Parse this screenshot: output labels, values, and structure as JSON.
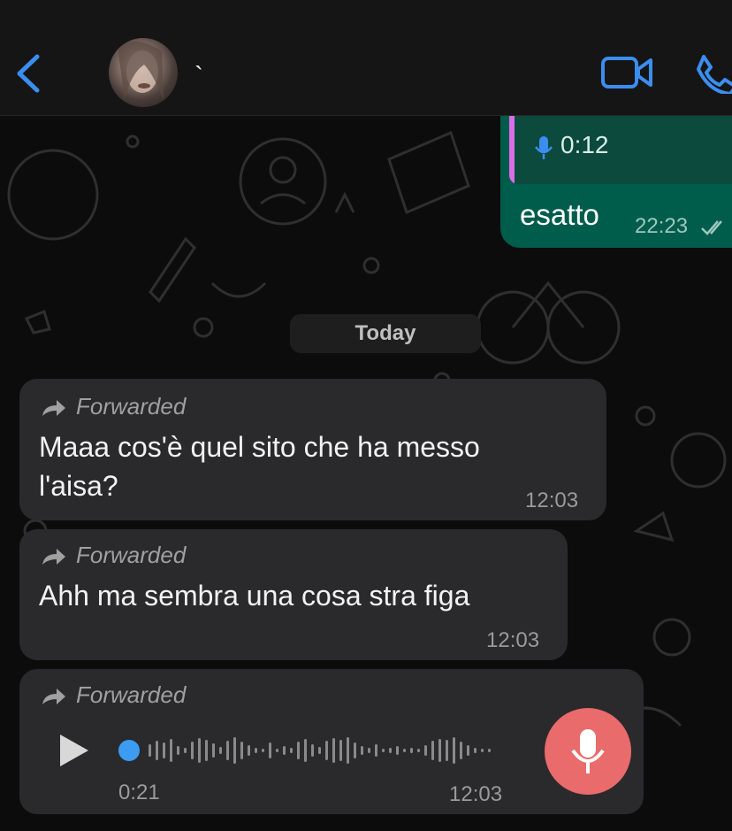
{
  "header": {
    "contact_name": "`",
    "icons": {
      "back": "chevron-left-icon",
      "video": "video-camera-icon",
      "call": "phone-icon"
    },
    "accent": "#3b8ef0"
  },
  "outgoing": {
    "quoted_voice_duration": "0:12",
    "text": "esatto",
    "time": "22:23"
  },
  "date_separator": "Today",
  "messages": [
    {
      "forwarded_label": "Forwarded",
      "text_line1": "Maaa cos'è quel sito che ha messo",
      "text_line2": "l'aisa?",
      "time": "12:03"
    },
    {
      "forwarded_label": "Forwarded",
      "text_line1": "Ahh ma sembra una cosa stra figa",
      "time": "12:03"
    },
    {
      "forwarded_label": "Forwarded",
      "voice_duration": "0:21",
      "time": "12:03"
    }
  ],
  "colors": {
    "outgoing_bubble": "#005c4b",
    "incoming_bubble": "#2a2a2c",
    "quote_bar": "#d96ee6",
    "mic_button": "#e96b6b"
  }
}
